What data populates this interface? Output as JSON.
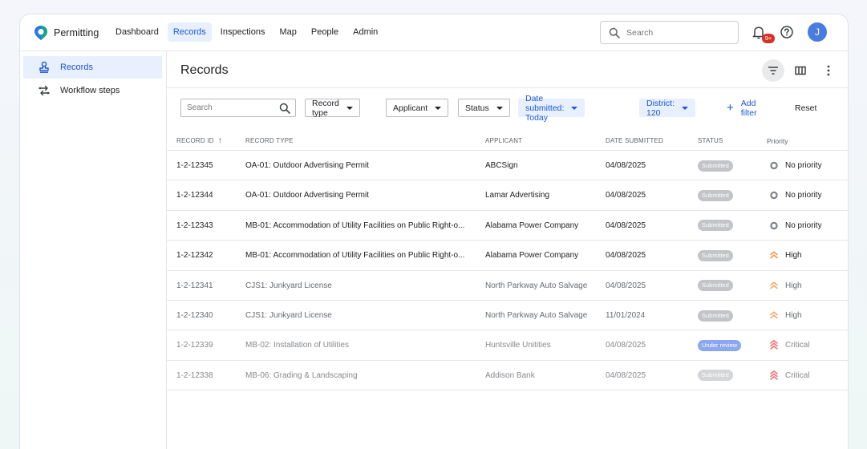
{
  "app": {
    "name": "Permitting"
  },
  "nav": [
    {
      "label": "Dashboard",
      "active": false
    },
    {
      "label": "Records",
      "active": true
    },
    {
      "label": "Inspections",
      "active": false
    },
    {
      "label": "Map",
      "active": false
    },
    {
      "label": "People",
      "active": false
    },
    {
      "label": "Admin",
      "active": false
    }
  ],
  "header": {
    "search_placeholder": "Search",
    "notifications_badge": "9+",
    "avatar_initial": "J"
  },
  "sidebar": {
    "items": [
      {
        "label": "Records",
        "icon": "stamp-icon",
        "active": true
      },
      {
        "label": "Workflow steps",
        "icon": "workflow-icon",
        "active": false
      }
    ]
  },
  "main": {
    "title": "Records",
    "filters": {
      "search_placeholder": "Search",
      "chips": [
        {
          "label": "Record type",
          "applied": false
        },
        {
          "label": "Applicant",
          "applied": false
        },
        {
          "label": "Status",
          "applied": false
        },
        {
          "label": "Date submitted: Today",
          "applied": true
        },
        {
          "label": "District: 120",
          "applied": true
        }
      ],
      "add_filter": "Add filter",
      "reset": "Reset"
    },
    "table": {
      "columns": [
        "RECORD ID",
        "RECORD TYPE",
        "APPLICANT",
        "DATE SUBMITTED",
        "STATUS",
        "Priority"
      ],
      "rows": [
        {
          "id": "1-2-12345",
          "type": "OA-01: Outdoor Advertising Permit",
          "applicant": "ABCSign",
          "date": "04/08/2025",
          "status": "Submitted",
          "priority": "No priority",
          "tone": "dark"
        },
        {
          "id": "1-2-12344",
          "type": "OA-01: Outdoor Advertising Permit",
          "applicant": "Lamar Advertising",
          "date": "04/08/2025",
          "status": "Submitted",
          "priority": "No priority",
          "tone": "dark"
        },
        {
          "id": "1-2-12343",
          "type": "MB-01: Accommodation of Utility Facilities on Public Right-o...",
          "applicant": "Alabama Power Company",
          "date": "04/08/2025",
          "status": "Submitted",
          "priority": "No priority",
          "tone": "dark"
        },
        {
          "id": "1-2-12342",
          "type": "MB-01: Accommodation of Utility Facilities on Public Right-o...",
          "applicant": "Alabama Power Company",
          "date": "04/08/2025",
          "status": "Submitted",
          "priority": "High",
          "tone": "dark"
        },
        {
          "id": "1-2-12341",
          "type": "CJS1: Junkyard License",
          "applicant": "North Parkway Auto Salvage",
          "date": "04/08/2025",
          "status": "Submitted",
          "priority": "High",
          "tone": "muted"
        },
        {
          "id": "1-2-12340",
          "type": "CJS1: Junkyard License",
          "applicant": "North Parkway Auto Salvage",
          "date": "11/01/2024",
          "status": "Submitted",
          "priority": "High",
          "tone": "muted"
        },
        {
          "id": "1-2-12339",
          "type": "MB-02: Installation of Utilities",
          "applicant": "Huntsville Unitities",
          "date": "04/08/2025",
          "status": "Under review",
          "priority": "Critical",
          "tone": "faded"
        },
        {
          "id": "1-2-12338",
          "type": "MB-06: Grading & Landscaping",
          "applicant": "Addison Bank",
          "date": "04/08/2025",
          "status": "Submitted",
          "priority": "Critical",
          "tone": "faded"
        }
      ]
    }
  },
  "colors": {
    "accent": "#1a56d6",
    "badge_submitted": "#c2c4c8",
    "badge_under_review": "#8aa7ef",
    "priority_high": "#f09a4f",
    "priority_critical": "#ee7b7b",
    "priority_none": "#7d848b"
  }
}
